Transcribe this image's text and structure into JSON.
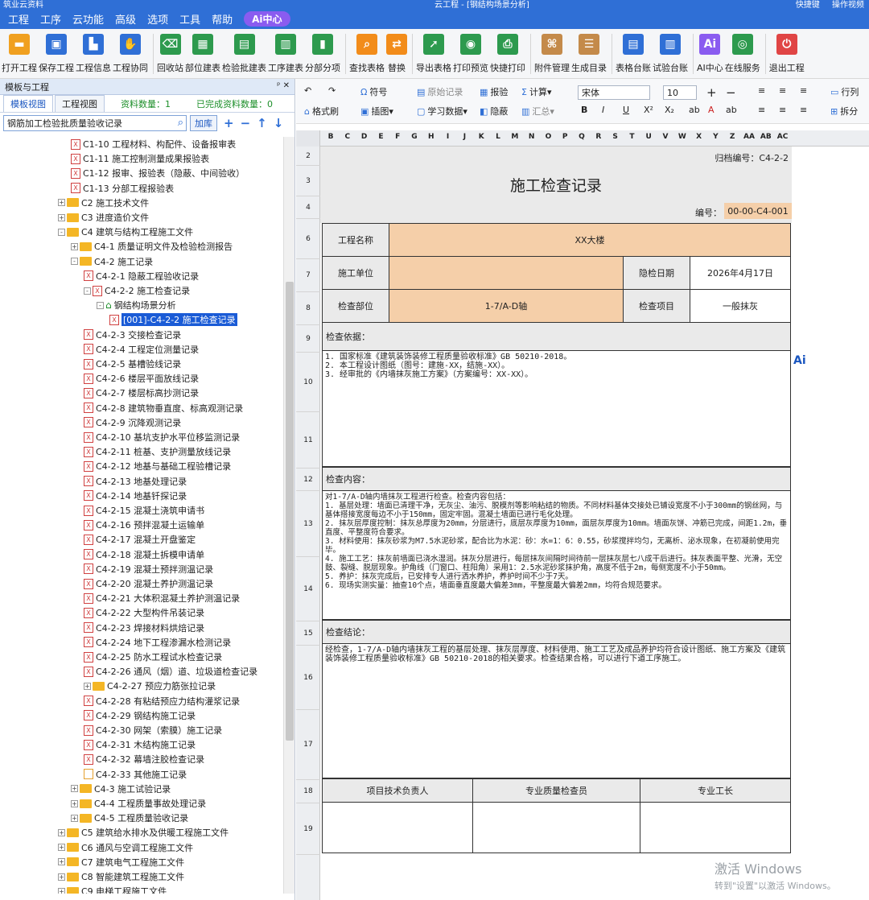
{
  "titlebar": {
    "app": "筑业云资料",
    "title": "云工程 - [钢结构场景分析]",
    "shortcut": "快捷键",
    "guide": "操作视频"
  },
  "menu": [
    "工程",
    "工序",
    "云功能",
    "高级",
    "选项",
    "工具",
    "帮助"
  ],
  "ai_center": "Ai中心",
  "toolbar": [
    {
      "label": "打开工程",
      "icon": "folder-icon",
      "color": "#f0a020"
    },
    {
      "label": "保存工程",
      "icon": "save-icon",
      "color": "#2f6fd6"
    },
    {
      "label": "工程信息",
      "icon": "building-icon",
      "color": "#2f6fd6"
    },
    {
      "label": "工程协同",
      "icon": "handshake-icon",
      "color": "#2f6fd6"
    },
    {
      "label": "回收站",
      "icon": "trash-icon",
      "color": "#2d9a4e"
    },
    {
      "label": "部位建表",
      "icon": "table-icon",
      "color": "#2d9a4e"
    },
    {
      "label": "检验批建表",
      "icon": "grid-icon",
      "color": "#2d9a4e"
    },
    {
      "label": "工序建表",
      "icon": "sequence-icon",
      "color": "#2d9a4e"
    },
    {
      "label": "分部分项",
      "icon": "chart-icon",
      "color": "#2d9a4e"
    },
    {
      "label": "查找表格",
      "icon": "search-icon",
      "color": "#f28c1a"
    },
    {
      "label": "替换",
      "icon": "replace-icon",
      "color": "#f28c1a"
    },
    {
      "label": "导出表格",
      "icon": "export-icon",
      "color": "#2d9a4e"
    },
    {
      "label": "打印预览",
      "icon": "preview-icon",
      "color": "#2d9a4e"
    },
    {
      "label": "快捷打印",
      "icon": "printer-icon",
      "color": "#2d9a4e"
    },
    {
      "label": "附件管理",
      "icon": "attachment-icon",
      "color": "#c48a4a"
    },
    {
      "label": "生成目录",
      "icon": "catalog-icon",
      "color": "#c48a4a"
    },
    {
      "label": "表格台账",
      "icon": "ledger-icon",
      "color": "#2f6fd6"
    },
    {
      "label": "试验台账",
      "icon": "test-ledger-icon",
      "color": "#2f6fd6"
    },
    {
      "label": "AI中心",
      "icon": "ai-icon",
      "color": "#8a5cf0"
    },
    {
      "label": "在线服务",
      "icon": "service-icon",
      "color": "#2d9a4e"
    },
    {
      "label": "退出工程",
      "icon": "power-icon",
      "color": "#e04545"
    }
  ],
  "left_panel": {
    "header": "模板与工程",
    "tabs": [
      "模板视图",
      "工程视图"
    ],
    "count_label": "资料数量：1",
    "done_label": "已完成资料数量：0",
    "search_value": "钢筋加工检验批质量验收记录",
    "add_lib": "加库",
    "tree": [
      {
        "level": 3,
        "type": "file",
        "text": "C1-10 工程材料、构配件、设备报审表"
      },
      {
        "level": 3,
        "type": "file",
        "text": "C1-11 施工控制测量成果报验表"
      },
      {
        "level": 3,
        "type": "file",
        "text": "C1-12 报审、报验表（隐蔽、中间验收）"
      },
      {
        "level": 3,
        "type": "file",
        "text": "C1-13 分部工程报验表"
      },
      {
        "level": 2,
        "type": "folder",
        "exp": "+",
        "text": "C2 施工技术文件"
      },
      {
        "level": 2,
        "type": "folder",
        "exp": "+",
        "text": "C3 进度造价文件"
      },
      {
        "level": 2,
        "type": "folder",
        "exp": "-",
        "text": "C4 建筑与结构工程施工文件"
      },
      {
        "level": 3,
        "type": "folder",
        "exp": "+",
        "text": "C4-1 质量证明文件及检验检测报告"
      },
      {
        "level": 3,
        "type": "folder",
        "exp": "-",
        "text": "C4-2 施工记录"
      },
      {
        "level": 4,
        "type": "file",
        "text": "C4-2-1 隐蔽工程验收记录"
      },
      {
        "level": 4,
        "type": "file",
        "exp": "-",
        "text": "C4-2-2 施工检查记录"
      },
      {
        "level": 5,
        "type": "house",
        "exp": "-",
        "text": "钢结构场景分析"
      },
      {
        "level": 6,
        "type": "file",
        "text": "[001]-C4-2-2 施工检查记录",
        "selected": true
      },
      {
        "level": 4,
        "type": "file",
        "text": "C4-2-3 交接检查记录"
      },
      {
        "level": 4,
        "type": "file",
        "text": "C4-2-4 工程定位测量记录"
      },
      {
        "level": 4,
        "type": "file",
        "text": "C4-2-5 基槽验线记录"
      },
      {
        "level": 4,
        "type": "file",
        "text": "C4-2-6 楼层平面放线记录"
      },
      {
        "level": 4,
        "type": "file",
        "text": "C4-2-7 楼层标高抄测记录"
      },
      {
        "level": 4,
        "type": "file",
        "text": "C4-2-8 建筑物垂直度、标高观测记录"
      },
      {
        "level": 4,
        "type": "file",
        "text": "C4-2-9 沉降观测记录"
      },
      {
        "level": 4,
        "type": "file",
        "text": "C4-2-10 基坑支护水平位移监测记录"
      },
      {
        "level": 4,
        "type": "file",
        "text": "C4-2-11 桩基、支护测量放线记录"
      },
      {
        "level": 4,
        "type": "file",
        "text": "C4-2-12 地基与基础工程验槽记录"
      },
      {
        "level": 4,
        "type": "file",
        "text": "C4-2-13 地基处理记录"
      },
      {
        "level": 4,
        "type": "file",
        "text": "C4-2-14 地基钎探记录"
      },
      {
        "level": 4,
        "type": "file",
        "text": "C4-2-15 混凝土浇筑申请书"
      },
      {
        "level": 4,
        "type": "file",
        "text": "C4-2-16 预拌混凝土运输单"
      },
      {
        "level": 4,
        "type": "file",
        "text": "C4-2-17 混凝土开盘鉴定"
      },
      {
        "level": 4,
        "type": "file",
        "text": "C4-2-18 混凝土拆模申请单"
      },
      {
        "level": 4,
        "type": "file",
        "text": "C4-2-19 混凝土预拌测温记录"
      },
      {
        "level": 4,
        "type": "file",
        "text": "C4-2-20 混凝土养护测温记录"
      },
      {
        "level": 4,
        "type": "file",
        "text": "C4-2-21 大体积混凝土养护测温记录"
      },
      {
        "level": 4,
        "type": "file",
        "text": "C4-2-22 大型构件吊装记录"
      },
      {
        "level": 4,
        "type": "file",
        "text": "C4-2-23 焊接材料烘焙记录"
      },
      {
        "level": 4,
        "type": "file",
        "text": "C4-2-24 地下工程渗漏水检测记录"
      },
      {
        "level": 4,
        "type": "file",
        "text": "C4-2-25 防水工程试水检查记录"
      },
      {
        "level": 4,
        "type": "file",
        "text": "C4-2-26 通风（烟）道、垃圾道检查记录"
      },
      {
        "level": 4,
        "type": "folder",
        "exp": "+",
        "text": "C4-2-27 预应力筋张拉记录"
      },
      {
        "level": 4,
        "type": "file",
        "text": "C4-2-28 有粘结预应力结构灌浆记录"
      },
      {
        "level": 4,
        "type": "file",
        "text": "C4-2-29 钢结构施工记录"
      },
      {
        "level": 4,
        "type": "file",
        "text": "C4-2-30 网架（索膜）施工记录"
      },
      {
        "level": 4,
        "type": "file",
        "text": "C4-2-31 木结构施工记录"
      },
      {
        "level": 4,
        "type": "file",
        "text": "C4-2-32 幕墙注胶检查记录"
      },
      {
        "level": 4,
        "type": "tfile",
        "text": "C4-2-33 其他施工记录"
      },
      {
        "level": 3,
        "type": "folder",
        "exp": "+",
        "text": "C4-3 施工试验记录"
      },
      {
        "level": 3,
        "type": "folder",
        "exp": "+",
        "text": "C4-4 工程质量事故处理记录"
      },
      {
        "level": 3,
        "type": "folder",
        "exp": "+",
        "text": "C4-5 工程质量验收记录"
      },
      {
        "level": 2,
        "type": "folder",
        "exp": "+",
        "text": "C5 建筑给水排水及供暖工程施工文件"
      },
      {
        "level": 2,
        "type": "folder",
        "exp": "+",
        "text": "C6 通风与空调工程施工文件"
      },
      {
        "level": 2,
        "type": "folder",
        "exp": "+",
        "text": "C7 建筑电气工程施工文件"
      },
      {
        "level": 2,
        "type": "folder",
        "exp": "+",
        "text": "C8 智能建筑工程施工文件"
      },
      {
        "level": 2,
        "type": "folder",
        "exp": "+",
        "text": "C9 电梯工程施工文件"
      }
    ]
  },
  "ribbon": {
    "symbol": "符号",
    "original": "原始记录",
    "report": "报验",
    "calc": "计算",
    "format_brush": "格式刷",
    "insert_image": "插图",
    "study": "学习数据",
    "hide": "隐蔽",
    "summary": "汇总",
    "font": "宋体",
    "size": "10",
    "row_col": "行列",
    "split": "拆分"
  },
  "columns": [
    "B",
    "C",
    "D",
    "E",
    "F",
    "G",
    "H",
    "I",
    "J",
    "K",
    "L",
    "M",
    "N",
    "O",
    "P",
    "Q",
    "R",
    "S",
    "T",
    "U",
    "V",
    "W",
    "X",
    "Y",
    "Z",
    "AA",
    "AB",
    "AC"
  ],
  "rows": [
    "2",
    "3",
    "4",
    "6",
    "7",
    "8",
    "9",
    "10",
    "11",
    "12",
    "13",
    "14",
    "15",
    "16",
    "17",
    "18",
    "19"
  ],
  "doc": {
    "archive_no": "归档编号：C4-2-2",
    "title": "施工检查记录",
    "code_label": "编号：",
    "code_value": "00-00-C4-001",
    "project_name_label": "工程名称",
    "project_name": "XX大楼",
    "unit_label": "施工单位",
    "unit_value": "",
    "check_date_label": "隐检日期",
    "check_date": "2026年4月17日",
    "location_label": "检查部位",
    "location": "1-7/A-D轴",
    "item_label": "检查项目",
    "item": "一般抹灰",
    "basis_label": "检查依据：",
    "basis_text": "1. 国家标准《建筑装饰装修工程质量验收标准》GB 50210-2018。\n2. 本工程设计图纸（图号：建施-XX，结施-XX）。\n3. 经审批的《内墙抹灰施工方案》（方案编号：XX-XX）。",
    "content_label": "检查内容：",
    "content_text": "对1-7/A-D轴内墙抹灰工程进行检查。检查内容包括：\n1. 基层处理：墙面已清理干净，无灰尘、油污、脱模剂等影响粘结的物质。不同材料基体交接处已铺设宽度不小于300mm的钢丝网，与基体搭接宽度每边不小于150mm，固定牢固。混凝土墙面已进行毛化处理。\n2. 抹灰层厚度控制：抹灰总厚度为20mm，分层进行，底层灰厚度为10mm，面层灰厚度为10mm。墙面灰饼、冲筋已完成，间距1.2m，垂直度、平整度符合要求。\n3. 材料使用：抹灰砂浆为M7.5水泥砂浆，配合比为水泥：砂：水=1：6：0.55，砂浆搅拌均匀，无离析、泌水现象，在初凝前使用完毕。\n4. 施工工艺：抹灰前墙面已浇水湿润。抹灰分层进行，每层抹灰间隔时间待前一层抹灰层七八成干后进行。抹灰表面平整、光滑，无空鼓、裂缝、脱层现象。护角线（门窗口、柱阳角）采用1：2.5水泥砂浆抹护角，高度不低于2m，每侧宽度不小于50mm。\n5. 养护：抹灰完成后，已安排专人进行洒水养护，养护时间不少于7天。\n6. 现场实测实量：抽查10个点，墙面垂直度最大偏差3mm，平整度最大偏差2mm，均符合规范要求。",
    "conclusion_label": "检查结论：",
    "conclusion_text": "经检查，1-7/A-D轴内墙抹灰工程的基层处理、抹灰层厚度、材料使用、施工工艺及成品养护均符合设计图纸、施工方案及《建筑装饰装修工程质量验收标准》GB 50210-2018的相关要求。检查结果合格，可以进行下道工序施工。",
    "sign1": "项目技术负责人",
    "sign2": "专业质量检查员",
    "sign3": "专业工长"
  },
  "watermark": {
    "line1": "激活 Windows",
    "line2": "转到\"设置\"以激活 Windows。"
  }
}
